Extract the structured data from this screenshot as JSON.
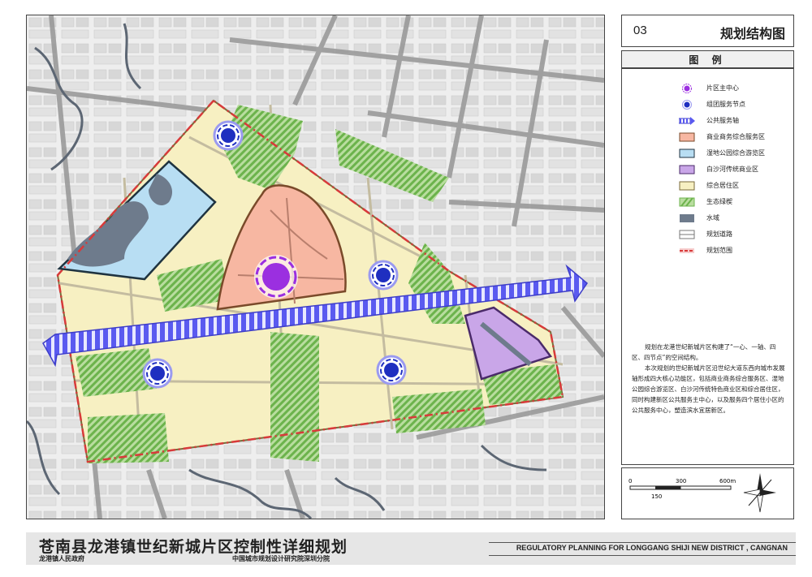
{
  "sheet": {
    "number": "03",
    "title": "规划结构图"
  },
  "legend": {
    "title": "图 例",
    "items": [
      {
        "label": "片区主中心",
        "symbol": "main-center-icon"
      },
      {
        "label": "组团服务节点",
        "symbol": "service-node-icon"
      },
      {
        "label": "公共服务轴",
        "symbol": "service-axis-icon"
      },
      {
        "label": "商业商务综合服务区",
        "symbol": "fill",
        "color": "#f7b7a2"
      },
      {
        "label": "湿地公园综合游览区",
        "symbol": "fill",
        "color": "#b8def3"
      },
      {
        "label": "白沙河传统商业区",
        "symbol": "fill",
        "color": "#c9a6e8"
      },
      {
        "label": "综合居住区",
        "symbol": "fill",
        "color": "#f7f0c2"
      },
      {
        "label": "生态绿楔",
        "symbol": "hatch",
        "color": "#7fc15e"
      },
      {
        "label": "水域",
        "symbol": "fill",
        "color": "#6e7b8c"
      },
      {
        "label": "规划道路",
        "symbol": "road"
      },
      {
        "label": "规划范围",
        "symbol": "boundary",
        "color": "#d83a3a"
      }
    ]
  },
  "description": [
    "规划在龙港世纪新城片区构建了“一心、一轴、四区、四节点”的空间结构。",
    "本次规划的世纪新城片区沿世纪大道东西向城市发展轴形成四大核心功能区，包括商业商务综合服务区、湿地公园综合游览区、白沙河传统特色商业区和综合居住区，同时构建新区公共服务主中心，以及服务四个居住小区的公共服务中心，塑造滨水宜居新区。"
  ],
  "scale": {
    "ticks": [
      "0",
      "150",
      "300",
      "600m"
    ]
  },
  "footer": {
    "title_cn": "苍南县龙港镇世纪新城片区控制性详细规划",
    "org_left": "龙港镇人民政府",
    "org_right": "中国城市规划设计研究院深圳分院",
    "title_en": "REGULATORY  PLANNING FOR LONGGANG SHIJI NEW DISTRICT , CANGNAN"
  },
  "colors": {
    "commercial": "#f7b7a2",
    "wetland": "#b8def3",
    "traditional": "#c9a6e8",
    "residential": "#f7f0c2",
    "green": "#7fc15e",
    "water": "#6e7b8c",
    "boundary": "#d83a3a",
    "axis": "#4a4ae8",
    "center": "#9b2fe0",
    "node": "#1f2fc0"
  }
}
